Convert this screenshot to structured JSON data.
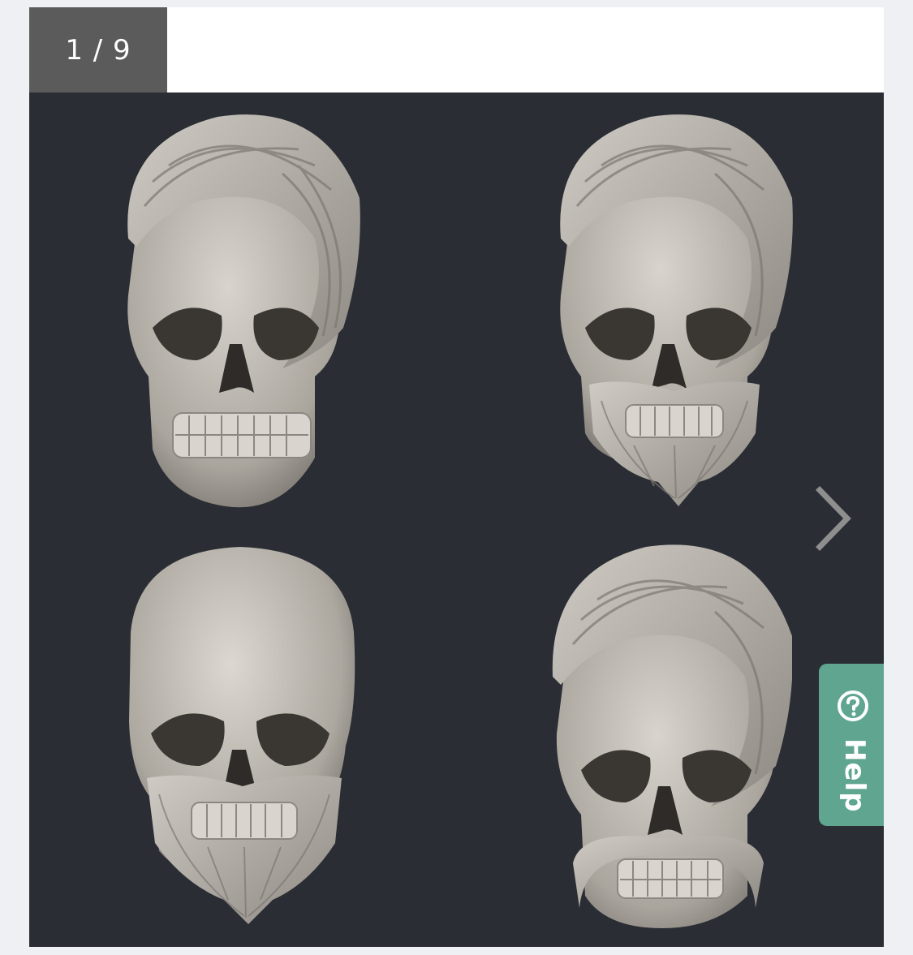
{
  "gallery": {
    "counter": "1 / 9",
    "images": [
      {
        "icon": "skull-with-hair-icon"
      },
      {
        "icon": "skull-with-hair-and-beard-icon"
      },
      {
        "icon": "skull-with-beard-icon"
      },
      {
        "icon": "skull-with-hair-and-mustache-icon"
      }
    ],
    "next_icon": "chevron-right-icon"
  },
  "help": {
    "label": "Help",
    "icon": "question-circle-icon",
    "color": "#5fa58f"
  },
  "colors": {
    "stage_background": "#2a2d33",
    "counter_background": "#5b5b5b",
    "sculpture": "#bdb9b2"
  }
}
